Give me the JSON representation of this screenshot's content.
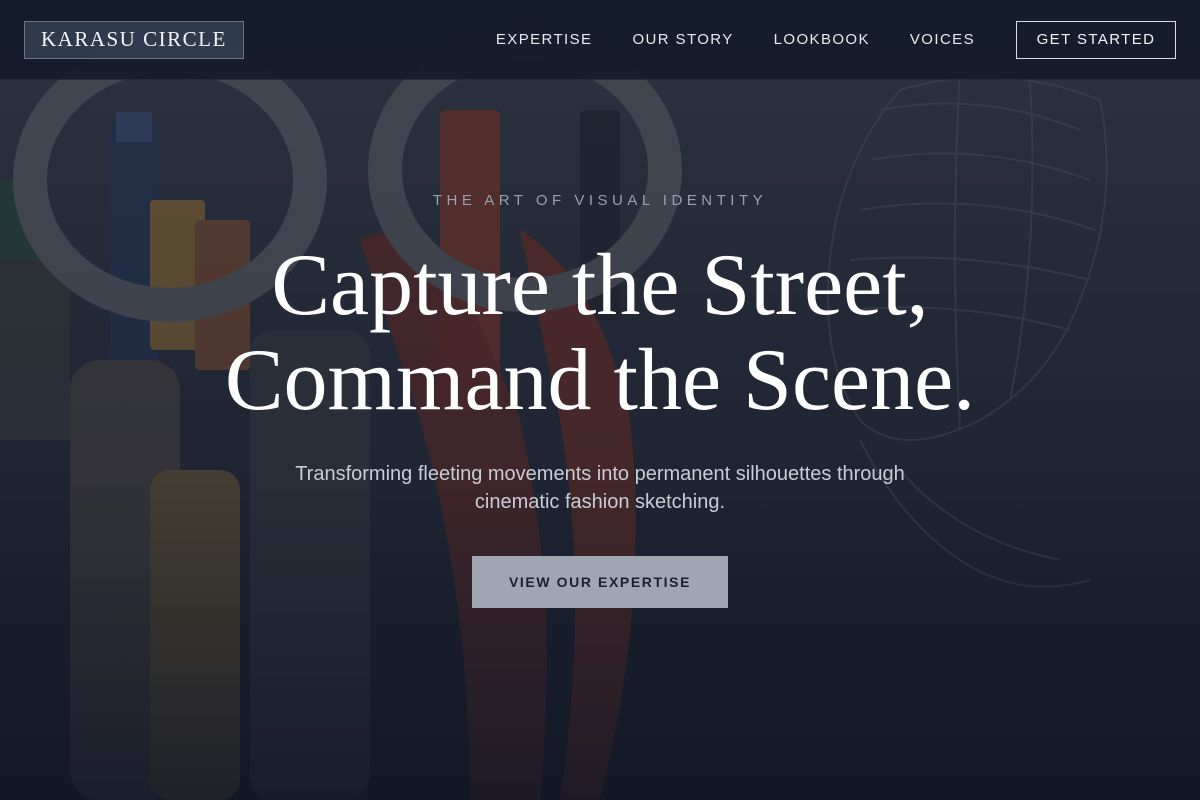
{
  "navbar": {
    "logo": "KARASU CIRCLE",
    "links": [
      {
        "label": "EXPERTISE"
      },
      {
        "label": "OUR STORY"
      },
      {
        "label": "LOOKBOOK"
      },
      {
        "label": "VOICES"
      }
    ],
    "cta": "GET STARTED"
  },
  "hero": {
    "eyebrow": "THE ART OF VISUAL IDENTITY",
    "headline_line1": "Capture the Street,",
    "headline_line2": "Command the Scene.",
    "subtext": "Transforming fleeting movements into permanent silhouettes through cinematic fashion sketching.",
    "button": "VIEW OUR EXPERTISE"
  },
  "colors": {
    "background": "#1b2130",
    "button_bg": "#9fa6b2",
    "text_primary": "#ffffff",
    "text_muted": "#9aa0ab"
  }
}
